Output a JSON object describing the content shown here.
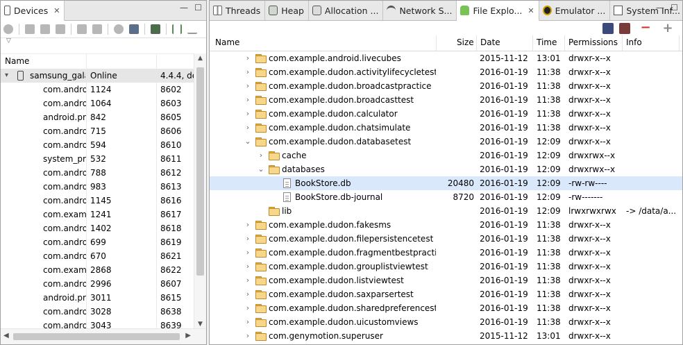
{
  "devices_panel": {
    "tab_label": "Devices",
    "close_glyph": "✕",
    "minimize_glyph": "—",
    "maximize_glyph": "☐",
    "columns": [
      "Name",
      "",
      ""
    ],
    "device": {
      "name": "samsung_gala",
      "status": "Online",
      "version": "4.4.4, de"
    },
    "processes": [
      {
        "name": "com.andro",
        "pid": "1124",
        "port": "8602"
      },
      {
        "name": "com.andro",
        "pid": "1064",
        "port": "8603"
      },
      {
        "name": "android.pr",
        "pid": "842",
        "port": "8605"
      },
      {
        "name": "com.andro",
        "pid": "715",
        "port": "8606"
      },
      {
        "name": "com.andro",
        "pid": "594",
        "port": "8610"
      },
      {
        "name": "system_prc",
        "pid": "532",
        "port": "8611"
      },
      {
        "name": "com.andro",
        "pid": "788",
        "port": "8612"
      },
      {
        "name": "com.andro",
        "pid": "983",
        "port": "8613"
      },
      {
        "name": "com.andro",
        "pid": "1145",
        "port": "8616"
      },
      {
        "name": "com.examp",
        "pid": "1241",
        "port": "8617"
      },
      {
        "name": "com.andro",
        "pid": "1402",
        "port": "8618"
      },
      {
        "name": "com.andro",
        "pid": "699",
        "port": "8619"
      },
      {
        "name": "com.andro",
        "pid": "670",
        "port": "8621"
      },
      {
        "name": "com.examp",
        "pid": "2868",
        "port": "8622"
      },
      {
        "name": "com.andro",
        "pid": "2996",
        "port": "8607"
      },
      {
        "name": "android.pr",
        "pid": "3011",
        "port": "8615"
      },
      {
        "name": "com.andro",
        "pid": "3028",
        "port": "8638"
      },
      {
        "name": "com.andro",
        "pid": "3043",
        "port": "8639"
      }
    ]
  },
  "tabs": [
    {
      "label": "Threads",
      "icon": "threads-icon"
    },
    {
      "label": "Heap",
      "icon": "heap-icon"
    },
    {
      "label": "Allocation ...",
      "icon": "allocation-icon"
    },
    {
      "label": "Network S...",
      "icon": "network-icon"
    },
    {
      "label": "File Explo...",
      "icon": "android-icon",
      "active": true
    },
    {
      "label": "Emulator ...",
      "icon": "emulator-icon"
    },
    {
      "label": "System Inf...",
      "icon": "system-info-icon"
    }
  ],
  "file_explorer": {
    "toolbar": {
      "minus": "−",
      "plus": "+"
    },
    "columns": {
      "name": "Name",
      "size": "Size",
      "date": "Date",
      "time": "Time",
      "permissions": "Permissions",
      "info": "Info"
    },
    "rows": [
      {
        "level": 0,
        "twisty": "›",
        "type": "folder",
        "name": "com.example.android.livecubes",
        "size": "",
        "date": "2015-11-12",
        "time": "13:01",
        "perm": "drwxr-x--x",
        "info": ""
      },
      {
        "level": 0,
        "twisty": "›",
        "type": "folder",
        "name": "com.example.dudon.activitylifecycletest",
        "size": "",
        "date": "2016-01-19",
        "time": "11:38",
        "perm": "drwxr-x--x",
        "info": ""
      },
      {
        "level": 0,
        "twisty": "›",
        "type": "folder",
        "name": "com.example.dudon.broadcastpractice",
        "size": "",
        "date": "2016-01-19",
        "time": "11:38",
        "perm": "drwxr-x--x",
        "info": ""
      },
      {
        "level": 0,
        "twisty": "›",
        "type": "folder",
        "name": "com.example.dudon.broadcasttest",
        "size": "",
        "date": "2016-01-19",
        "time": "11:38",
        "perm": "drwxr-x--x",
        "info": ""
      },
      {
        "level": 0,
        "twisty": "›",
        "type": "folder",
        "name": "com.example.dudon.calculator",
        "size": "",
        "date": "2016-01-19",
        "time": "11:38",
        "perm": "drwxr-x--x",
        "info": ""
      },
      {
        "level": 0,
        "twisty": "›",
        "type": "folder",
        "name": "com.example.dudon.chatsimulate",
        "size": "",
        "date": "2016-01-19",
        "time": "11:38",
        "perm": "drwxr-x--x",
        "info": ""
      },
      {
        "level": 0,
        "twisty": "⌄",
        "type": "folder",
        "name": "com.example.dudon.databasetest",
        "size": "",
        "date": "2016-01-19",
        "time": "12:09",
        "perm": "drwxr-x--x",
        "info": ""
      },
      {
        "level": 1,
        "twisty": "›",
        "type": "folder",
        "name": "cache",
        "size": "",
        "date": "2016-01-19",
        "time": "12:09",
        "perm": "drwxrwx--x",
        "info": ""
      },
      {
        "level": 1,
        "twisty": "⌄",
        "type": "folder",
        "name": "databases",
        "size": "",
        "date": "2016-01-19",
        "time": "12:09",
        "perm": "drwxrwx--x",
        "info": ""
      },
      {
        "level": 2,
        "twisty": "",
        "type": "file",
        "name": "BookStore.db",
        "size": "20480",
        "date": "2016-01-19",
        "time": "12:09",
        "perm": "-rw-rw----",
        "info": "",
        "selected": true
      },
      {
        "level": 2,
        "twisty": "",
        "type": "file",
        "name": "BookStore.db-journal",
        "size": "8720",
        "date": "2016-01-19",
        "time": "12:09",
        "perm": "-rw-------",
        "info": ""
      },
      {
        "level": 1,
        "twisty": "",
        "type": "folder",
        "name": "lib",
        "size": "",
        "date": "2016-01-19",
        "time": "12:09",
        "perm": "lrwxrwxrwx",
        "info": "-> /data/a..."
      },
      {
        "level": 0,
        "twisty": "›",
        "type": "folder",
        "name": "com.example.dudon.fakesms",
        "size": "",
        "date": "2016-01-19",
        "time": "11:38",
        "perm": "drwxr-x--x",
        "info": ""
      },
      {
        "level": 0,
        "twisty": "›",
        "type": "folder",
        "name": "com.example.dudon.filepersistencetest",
        "size": "",
        "date": "2016-01-19",
        "time": "11:38",
        "perm": "drwxr-x--x",
        "info": ""
      },
      {
        "level": 0,
        "twisty": "›",
        "type": "folder",
        "name": "com.example.dudon.fragmentbestpractice",
        "size": "",
        "date": "2016-01-19",
        "time": "11:38",
        "perm": "drwxr-x--x",
        "info": ""
      },
      {
        "level": 0,
        "twisty": "›",
        "type": "folder",
        "name": "com.example.dudon.grouplistviewtest",
        "size": "",
        "date": "2016-01-19",
        "time": "11:38",
        "perm": "drwxr-x--x",
        "info": ""
      },
      {
        "level": 0,
        "twisty": "›",
        "type": "folder",
        "name": "com.example.dudon.listviewtest",
        "size": "",
        "date": "2016-01-19",
        "time": "11:38",
        "perm": "drwxr-x--x",
        "info": ""
      },
      {
        "level": 0,
        "twisty": "›",
        "type": "folder",
        "name": "com.example.dudon.saxparsertest",
        "size": "",
        "date": "2016-01-19",
        "time": "11:38",
        "perm": "drwxr-x--x",
        "info": ""
      },
      {
        "level": 0,
        "twisty": "›",
        "type": "folder",
        "name": "com.example.dudon.sharedpreferencestes",
        "size": "",
        "date": "2016-01-19",
        "time": "11:38",
        "perm": "drwxr-x--x",
        "info": ""
      },
      {
        "level": 0,
        "twisty": "›",
        "type": "folder",
        "name": "com.example.dudon.uicustomviews",
        "size": "",
        "date": "2016-01-19",
        "time": "11:38",
        "perm": "drwxr-x--x",
        "info": ""
      },
      {
        "level": 0,
        "twisty": "›",
        "type": "folder",
        "name": "com.genymotion.superuser",
        "size": "",
        "date": "2015-11-12",
        "time": "13:01",
        "perm": "drwxr-x--x",
        "info": ""
      }
    ]
  },
  "colors": {
    "selection": "#d9e8fb",
    "accent_red": "#d32f2f",
    "android_green": "#78c257"
  }
}
